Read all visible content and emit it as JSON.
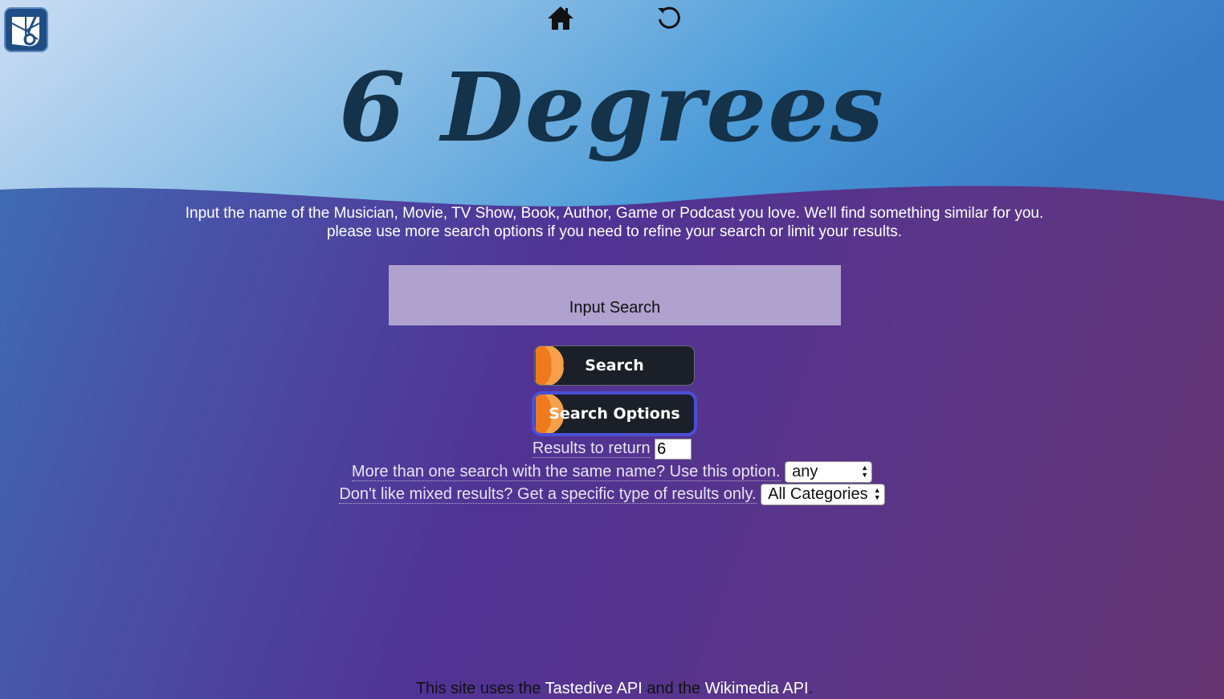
{
  "header": {
    "title": "6 Degrees",
    "logo_icon": "paint-palette-logo-icon",
    "home_icon": "home-icon",
    "refresh_icon": "refresh-icon"
  },
  "intro": {
    "line1": "Input the name of the Musician, Movie, TV Show, Book, Author, Game or Podcast you love. We'll find something similar for you.",
    "line2": "please use more search options if you need to refine your search or limit your results."
  },
  "search": {
    "placeholder": "Input Search",
    "value": ""
  },
  "buttons": {
    "search_label": "Search",
    "options_label": "Search Options"
  },
  "options": {
    "results_label": "Results to return",
    "results_value": "6",
    "same_name_label": "More than one search with the same name? Use this option.",
    "same_name_selected": "any",
    "category_label": "Don't like mixed results? Get a specific type of results only.",
    "category_selected": "All Categories"
  },
  "footer": {
    "text_prefix": "This site uses the",
    "link1": "Tastedive API",
    "text_middle": "and the",
    "link2": "Wikimedia API",
    "text_suffix": "."
  },
  "colors": {
    "hero_light": "#c9dcf2",
    "hero_dark": "#3a80c8",
    "title": "#14324a",
    "button_bg": "#1b2028",
    "button_accent": "#f6a04a",
    "button_accent_dark": "#ef7a1e",
    "focus_ring": "#4c4fd6",
    "search_bg": "#b0a2cf"
  }
}
